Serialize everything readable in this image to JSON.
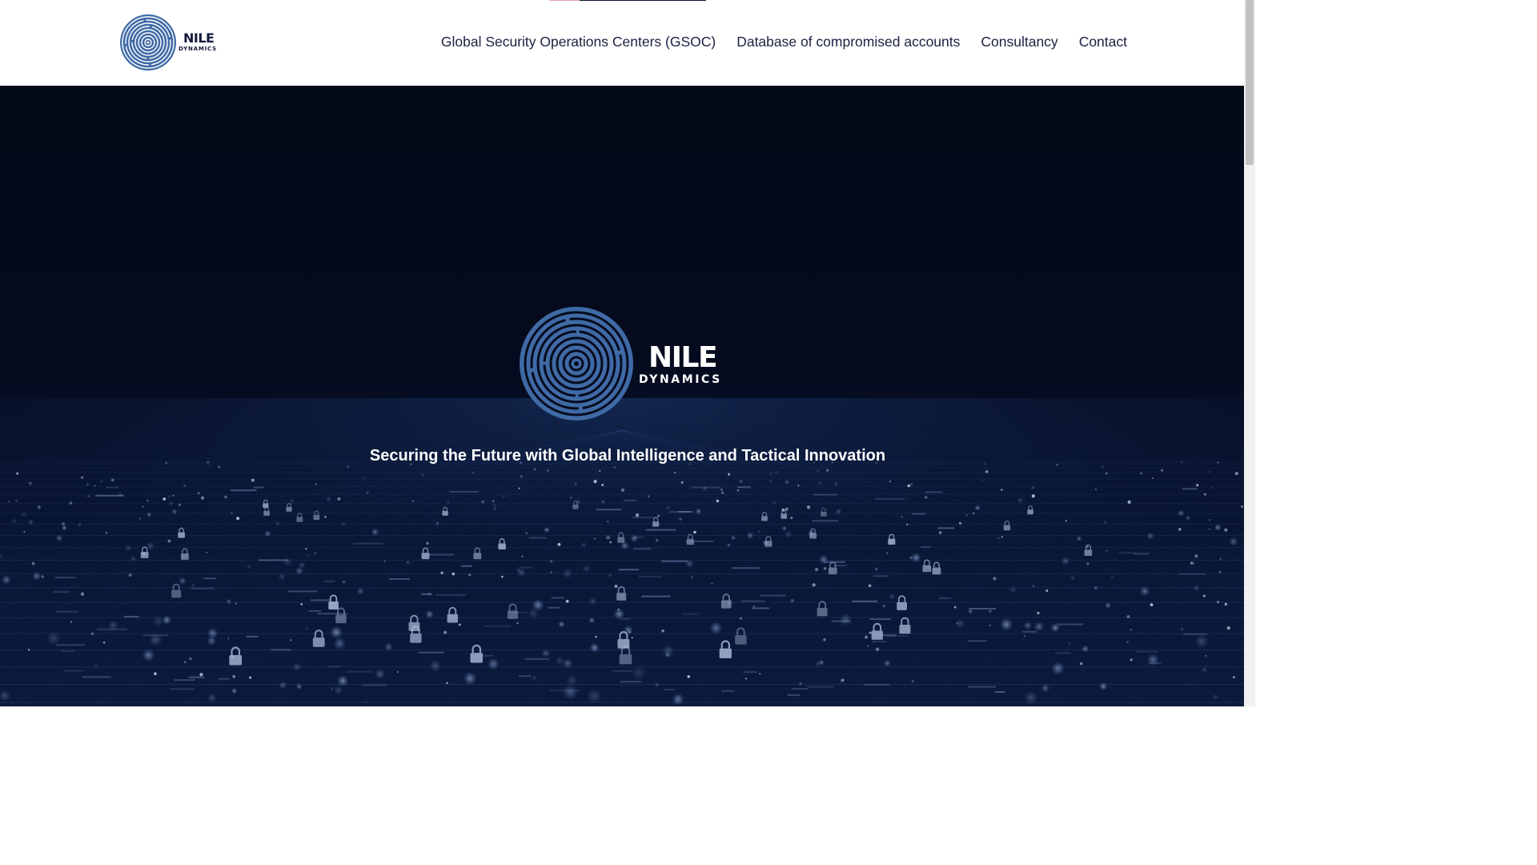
{
  "header": {
    "logo": {
      "wordmark": "NILE",
      "submark": "DYNAMICS",
      "icon": "tree-ring-icon",
      "color": "#3f6aa6"
    },
    "nav": [
      {
        "label": "Global Security Operations Centers (GSOC)"
      },
      {
        "label": "Database of compromised accounts"
      },
      {
        "label": "Consultancy"
      },
      {
        "label": "Contact"
      }
    ]
  },
  "hero": {
    "logo": {
      "wordmark": "NILE",
      "submark": "DYNAMICS",
      "icon": "tree-ring-icon"
    },
    "tagline": "Securing the Future with Global Intelligence and Tactical Innovation",
    "background": "digital-network-lock-grid",
    "colors": {
      "base": "#050b1e",
      "accent": "#3f6aa6"
    }
  },
  "colors": {
    "brand_blue": "#3f6aa6",
    "nav_text": "#1b2140",
    "header_bg": "#ffffff"
  }
}
